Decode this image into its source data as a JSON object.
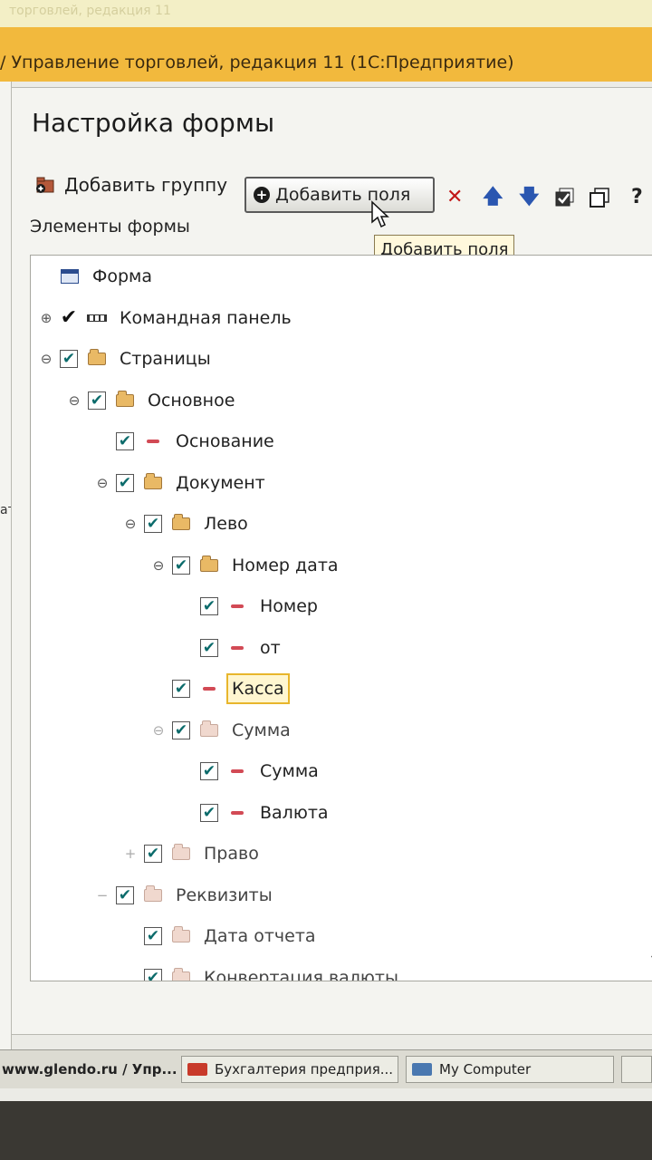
{
  "window": {
    "ghost_title": "торговлей, редакция 11",
    "app_title": "/ Управление торговлей, редакция 11  (1С:Предприятие)"
  },
  "left_fragment": "ат",
  "dialog": {
    "title": "Настройка формы",
    "toolbar": {
      "add_group": "Добавить группу",
      "add_fields": "Добавить поля",
      "tooltip": "Добавить поля",
      "help": "?"
    },
    "section_label": "Элементы формы",
    "tree": [
      {
        "label": "Форма",
        "level": 0,
        "icon": "form-icon",
        "checked": null,
        "expander": ""
      },
      {
        "label": "Командная панель",
        "level": 0,
        "icon": "command-panel-icon",
        "checked": true,
        "expander": "⊕",
        "plain_check": true
      },
      {
        "label": "Страницы",
        "level": 0,
        "icon": "folder-icon",
        "checked": true,
        "expander": "⊖"
      },
      {
        "label": "Основное",
        "level": 1,
        "icon": "folder-icon",
        "checked": true,
        "expander": "⊖"
      },
      {
        "label": "Основание",
        "level": 2,
        "icon": "field-icon",
        "checked": true,
        "expander": ""
      },
      {
        "label": "Документ",
        "level": 2,
        "icon": "folder-icon",
        "checked": true,
        "expander": "⊖"
      },
      {
        "label": "Лево",
        "level": 3,
        "icon": "folder-icon",
        "checked": true,
        "expander": "⊖"
      },
      {
        "label": "Номер дата",
        "level": 4,
        "icon": "folder-icon",
        "checked": true,
        "expander": "⊖"
      },
      {
        "label": "Номер",
        "level": 5,
        "icon": "field-icon",
        "checked": true,
        "expander": ""
      },
      {
        "label": "от",
        "level": 5,
        "icon": "field-icon",
        "checked": true,
        "expander": ""
      },
      {
        "label": "Касса",
        "level": 4,
        "icon": "field-icon",
        "checked": true,
        "expander": "",
        "selected": true
      },
      {
        "label": "Сумма",
        "level": 4,
        "icon": "folder-icon",
        "checked": true,
        "expander": "⊖",
        "faded": true
      },
      {
        "label": "Сумма",
        "level": 5,
        "icon": "field-icon",
        "checked": true,
        "expander": ""
      },
      {
        "label": "Валюта",
        "level": 5,
        "icon": "field-icon",
        "checked": true,
        "expander": ""
      },
      {
        "label": "Право",
        "level": 3,
        "icon": "folder-icon",
        "checked": true,
        "expander": "+",
        "faded": true
      },
      {
        "label": "Реквизиты",
        "level": 2,
        "icon": "folder-icon",
        "checked": true,
        "expander": "−",
        "faded": true
      },
      {
        "label": "Дата отчета",
        "level": 3,
        "icon": "folder-icon",
        "checked": true,
        "expander": "",
        "faded": true
      },
      {
        "label": "Конвертация валюты",
        "level": 3,
        "icon": "folder-icon",
        "checked": true,
        "expander": "",
        "faded": true
      }
    ]
  },
  "taskbar": {
    "item1": "www.glendo.ru / Упр...",
    "item2": "Бухгалтерия предприя...",
    "item3": "My Computer"
  }
}
